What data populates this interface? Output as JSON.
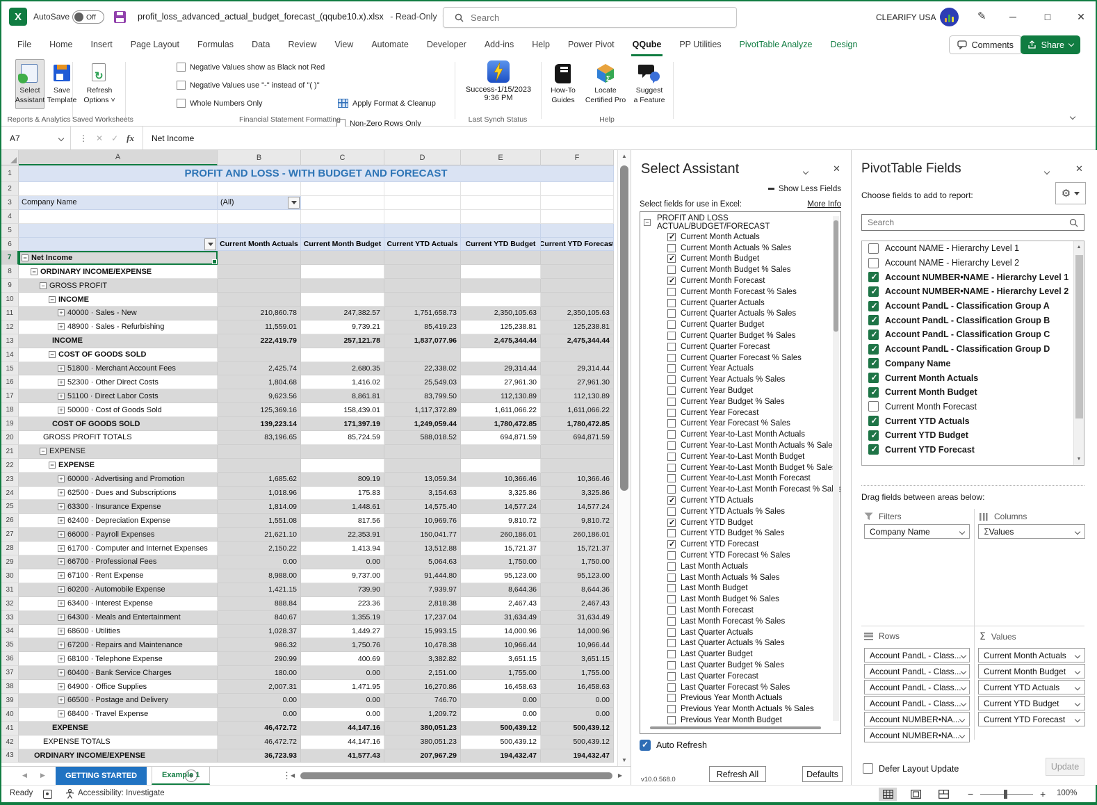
{
  "title_bar": {
    "autosave_label": "AutoSave",
    "autosave_state": "Off",
    "filename": "profit_loss_advanced_actual_budget_forecast_(qqube10.x).xlsx",
    "readonly": "-  Read-Only",
    "search_placeholder": "Search",
    "account_name": "CLEARIFY USA"
  },
  "menu_tabs": [
    {
      "label": "File"
    },
    {
      "label": "Home"
    },
    {
      "label": "Insert"
    },
    {
      "label": "Page Layout"
    },
    {
      "label": "Formulas"
    },
    {
      "label": "Data"
    },
    {
      "label": "Review"
    },
    {
      "label": "View"
    },
    {
      "label": "Automate"
    },
    {
      "label": "Developer"
    },
    {
      "label": "Add-ins"
    },
    {
      "label": "Help"
    },
    {
      "label": "Power Pivot"
    },
    {
      "label": "QQube",
      "active": true
    },
    {
      "label": "PP Utilities"
    },
    {
      "label": "PivotTable Analyze",
      "contextual": true
    },
    {
      "label": "Design",
      "contextual": true
    }
  ],
  "tab_actions": {
    "comments": "Comments",
    "share": "Share"
  },
  "ribbon": {
    "groups": [
      "Reports & Analytics",
      "Saved  Worksheets",
      "Financial Statement Formatting",
      "Last Synch Status",
      "Help"
    ],
    "select_assistant": "Select\nAssistant",
    "save_template": "Save\nTemplate",
    "refresh_options": "Refresh\nOptions ˅",
    "checkboxes_col1": [
      "Negative Values show as Black not Red",
      "Negative Values use \"-\" instead of \"( )\"",
      "Whole Numbers Only"
    ],
    "checkboxes_col2": [
      "Non-Zero Rows Only"
    ],
    "apply_format": "Apply Format & Cleanup",
    "synch_status": "Success-1/15/2023 9:36 PM",
    "howto": "How-To\nGuides",
    "locate": "Locate\nCertified Pro",
    "suggest": "Suggest\na Feature"
  },
  "formula_bar": {
    "cell_ref": "A7",
    "fx": "fx",
    "content": "Net Income"
  },
  "grid": {
    "columns": [
      "A",
      "B",
      "C",
      "D",
      "E",
      "F"
    ],
    "title": "PROFIT AND LOSS - WITH BUDGET AND FORECAST",
    "filter_label": "Company Name",
    "filter_value": "(All)",
    "value_headers": [
      "Current Month Actuals",
      "Current Month Budget",
      "Current YTD Actuals",
      "Current YTD Budget",
      "Current YTD Forecast"
    ],
    "rows": [
      {
        "n": 7,
        "label": "Net Income",
        "lvl": 0,
        "box": "-",
        "bold": true,
        "sel": true,
        "vals": [
          "",
          "",
          "",
          "",
          ""
        ]
      },
      {
        "n": 8,
        "label": "ORDINARY INCOME/EXPENSE",
        "lvl": 1,
        "box": "-",
        "bold": true,
        "vals": [
          "",
          "",
          "",
          "",
          ""
        ]
      },
      {
        "n": 9,
        "label": "GROSS PROFIT",
        "lvl": 2,
        "box": "-",
        "bold": false,
        "vals": [
          "",
          "",
          "",
          "",
          ""
        ]
      },
      {
        "n": 10,
        "label": "INCOME",
        "lvl": 3,
        "box": "-",
        "bold": true,
        "vals": [
          "",
          "",
          "",
          "",
          ""
        ]
      },
      {
        "n": 11,
        "label": "40000 · Sales - New",
        "lvl": 4,
        "box": "+",
        "bold": false,
        "vals": [
          "210,860.78",
          "247,382.57",
          "1,751,658.73",
          "2,350,105.63",
          "2,350,105.63"
        ]
      },
      {
        "n": 12,
        "label": "48900 · Sales - Refurbishing",
        "lvl": 4,
        "box": "+",
        "bold": false,
        "vals": [
          "11,559.01",
          "9,739.21",
          "85,419.23",
          "125,238.81",
          "125,238.81"
        ]
      },
      {
        "n": 13,
        "label": "INCOME",
        "lvl": 3,
        "box": "",
        "bold": true,
        "vals": [
          "222,419.79",
          "257,121.78",
          "1,837,077.96",
          "2,475,344.44",
          "2,475,344.44"
        ]
      },
      {
        "n": 14,
        "label": "COST OF GOODS SOLD",
        "lvl": 3,
        "box": "-",
        "bold": true,
        "vals": [
          "",
          "",
          "",
          "",
          ""
        ]
      },
      {
        "n": 15,
        "label": "51800 · Merchant Account Fees",
        "lvl": 4,
        "box": "+",
        "bold": false,
        "vals": [
          "2,425.74",
          "2,680.35",
          "22,338.02",
          "29,314.44",
          "29,314.44"
        ]
      },
      {
        "n": 16,
        "label": "52300 · Other Direct Costs",
        "lvl": 4,
        "box": "+",
        "bold": false,
        "vals": [
          "1,804.68",
          "1,416.02",
          "25,549.03",
          "27,961.30",
          "27,961.30"
        ]
      },
      {
        "n": 17,
        "label": "51100 · Direct Labor Costs",
        "lvl": 4,
        "box": "+",
        "bold": false,
        "vals": [
          "9,623.56",
          "8,861.81",
          "83,799.50",
          "112,130.89",
          "112,130.89"
        ]
      },
      {
        "n": 18,
        "label": "50000 · Cost of Goods Sold",
        "lvl": 4,
        "box": "+",
        "bold": false,
        "vals": [
          "125,369.16",
          "158,439.01",
          "1,117,372.89",
          "1,611,066.22",
          "1,611,066.22"
        ]
      },
      {
        "n": 19,
        "label": "COST OF GOODS SOLD",
        "lvl": 3,
        "box": "",
        "bold": true,
        "vals": [
          "139,223.14",
          "171,397.19",
          "1,249,059.44",
          "1,780,472.85",
          "1,780,472.85"
        ]
      },
      {
        "n": 20,
        "label": "GROSS PROFIT TOTALS",
        "lvl": 2,
        "box": "",
        "bold": false,
        "vals": [
          "83,196.65",
          "85,724.59",
          "588,018.52",
          "694,871.59",
          "694,871.59"
        ]
      },
      {
        "n": 21,
        "label": "EXPENSE",
        "lvl": 2,
        "box": "-",
        "bold": false,
        "vals": [
          "",
          "",
          "",
          "",
          ""
        ]
      },
      {
        "n": 22,
        "label": "EXPENSE",
        "lvl": 3,
        "box": "-",
        "bold": true,
        "vals": [
          "",
          "",
          "",
          "",
          ""
        ]
      },
      {
        "n": 23,
        "label": "60000 · Advertising and Promotion",
        "lvl": 4,
        "box": "+",
        "bold": false,
        "vals": [
          "1,685.62",
          "809.19",
          "13,059.34",
          "10,366.46",
          "10,366.46"
        ]
      },
      {
        "n": 24,
        "label": "62500 · Dues and Subscriptions",
        "lvl": 4,
        "box": "+",
        "bold": false,
        "vals": [
          "1,018.96",
          "175.83",
          "3,154.63",
          "3,325.86",
          "3,325.86"
        ]
      },
      {
        "n": 25,
        "label": "63300 · Insurance Expense",
        "lvl": 4,
        "box": "+",
        "bold": false,
        "vals": [
          "1,814.09",
          "1,448.61",
          "14,575.40",
          "14,577.24",
          "14,577.24"
        ]
      },
      {
        "n": 26,
        "label": "62400 · Depreciation Expense",
        "lvl": 4,
        "box": "+",
        "bold": false,
        "vals": [
          "1,551.08",
          "817.56",
          "10,969.76",
          "9,810.72",
          "9,810.72"
        ]
      },
      {
        "n": 27,
        "label": "66000 · Payroll Expenses",
        "lvl": 4,
        "box": "+",
        "bold": false,
        "vals": [
          "21,621.10",
          "22,353.91",
          "150,041.77",
          "260,186.01",
          "260,186.01"
        ]
      },
      {
        "n": 28,
        "label": "61700 · Computer and Internet Expenses",
        "lvl": 4,
        "box": "+",
        "bold": false,
        "vals": [
          "2,150.22",
          "1,413.94",
          "13,512.88",
          "15,721.37",
          "15,721.37"
        ]
      },
      {
        "n": 29,
        "label": "66700 · Professional Fees",
        "lvl": 4,
        "box": "+",
        "bold": false,
        "vals": [
          "0.00",
          "0.00",
          "5,064.63",
          "1,750.00",
          "1,750.00"
        ]
      },
      {
        "n": 30,
        "label": "67100 · Rent Expense",
        "lvl": 4,
        "box": "+",
        "bold": false,
        "vals": [
          "8,988.00",
          "9,737.00",
          "91,444.80",
          "95,123.00",
          "95,123.00"
        ]
      },
      {
        "n": 31,
        "label": "60200 · Automobile Expense",
        "lvl": 4,
        "box": "+",
        "bold": false,
        "vals": [
          "1,421.15",
          "739.90",
          "7,939.97",
          "8,644.36",
          "8,644.36"
        ]
      },
      {
        "n": 32,
        "label": "63400 · Interest Expense",
        "lvl": 4,
        "box": "+",
        "bold": false,
        "vals": [
          "888.84",
          "223.36",
          "2,818.38",
          "2,467.43",
          "2,467.43"
        ]
      },
      {
        "n": 33,
        "label": "64300 · Meals and Entertainment",
        "lvl": 4,
        "box": "+",
        "bold": false,
        "vals": [
          "840.67",
          "1,355.19",
          "17,237.04",
          "31,634.49",
          "31,634.49"
        ]
      },
      {
        "n": 34,
        "label": "68600 · Utilities",
        "lvl": 4,
        "box": "+",
        "bold": false,
        "vals": [
          "1,028.37",
          "1,449.27",
          "15,993.15",
          "14,000.96",
          "14,000.96"
        ]
      },
      {
        "n": 35,
        "label": "67200 · Repairs and Maintenance",
        "lvl": 4,
        "box": "+",
        "bold": false,
        "vals": [
          "986.32",
          "1,750.76",
          "10,478.38",
          "10,966.44",
          "10,966.44"
        ]
      },
      {
        "n": 36,
        "label": "68100 · Telephone Expense",
        "lvl": 4,
        "box": "+",
        "bold": false,
        "vals": [
          "290.99",
          "400.69",
          "3,382.82",
          "3,651.15",
          "3,651.15"
        ]
      },
      {
        "n": 37,
        "label": "60400 · Bank Service Charges",
        "lvl": 4,
        "box": "+",
        "bold": false,
        "vals": [
          "180.00",
          "0.00",
          "2,151.00",
          "1,755.00",
          "1,755.00"
        ]
      },
      {
        "n": 38,
        "label": "64900 · Office Supplies",
        "lvl": 4,
        "box": "+",
        "bold": false,
        "vals": [
          "2,007.31",
          "1,471.95",
          "16,270.86",
          "16,458.63",
          "16,458.63"
        ]
      },
      {
        "n": 39,
        "label": "66500 · Postage and Delivery",
        "lvl": 4,
        "box": "+",
        "bold": false,
        "vals": [
          "0.00",
          "0.00",
          "746.70",
          "0.00",
          "0.00"
        ]
      },
      {
        "n": 40,
        "label": "68400 · Travel Expense",
        "lvl": 4,
        "box": "+",
        "bold": false,
        "vals": [
          "0.00",
          "0.00",
          "1,209.72",
          "0.00",
          "0.00"
        ]
      },
      {
        "n": 41,
        "label": "EXPENSE",
        "lvl": 3,
        "box": "",
        "bold": true,
        "vals": [
          "46,472.72",
          "44,147.16",
          "380,051.23",
          "500,439.12",
          "500,439.12"
        ]
      },
      {
        "n": 42,
        "label": "EXPENSE TOTALS",
        "lvl": 2,
        "box": "",
        "bold": false,
        "vals": [
          "46,472.72",
          "44,147.16",
          "380,051.23",
          "500,439.12",
          "500,439.12"
        ]
      },
      {
        "n": 43,
        "label": "ORDINARY INCOME/EXPENSE",
        "lvl": 1,
        "box": "",
        "bold": true,
        "vals": [
          "36,723.93",
          "41,577.43",
          "207,967.29",
          "194,432.47",
          "194,432.47"
        ]
      }
    ]
  },
  "sheet_tabs": {
    "tabs": [
      {
        "label": "GETTING STARTED",
        "color": "blue"
      },
      {
        "label": "Example 1",
        "active": true
      }
    ]
  },
  "status_bar": {
    "ready": "Ready",
    "accessibility": "Accessibility: Investigate",
    "zoom": "100%"
  },
  "select_assistant": {
    "title": "Select Assistant",
    "show_less": "Show Less Fields",
    "select_label": "Select fields for use in Excel:",
    "more_info": "More Info",
    "root": "PROFIT AND LOSS ACTUAL/BUDGET/FORECAST",
    "items": [
      {
        "label": "Current Month Actuals",
        "checked": true
      },
      {
        "label": "Current Month Actuals % Sales",
        "checked": false
      },
      {
        "label": "Current Month Budget",
        "checked": true
      },
      {
        "label": "Current Month Budget % Sales",
        "checked": false
      },
      {
        "label": "Current Month Forecast",
        "checked": true
      },
      {
        "label": "Current Month Forecast % Sales",
        "checked": false
      },
      {
        "label": "Current Quarter Actuals",
        "checked": false
      },
      {
        "label": "Current Quarter Actuals % Sales",
        "checked": false
      },
      {
        "label": "Current Quarter Budget",
        "checked": false
      },
      {
        "label": "Current Quarter Budget % Sales",
        "checked": false
      },
      {
        "label": "Current Quarter Forecast",
        "checked": false
      },
      {
        "label": "Current Quarter Forecast % Sales",
        "checked": false
      },
      {
        "label": "Current Year Actuals",
        "checked": false
      },
      {
        "label": "Current Year Actuals % Sales",
        "checked": false
      },
      {
        "label": "Current Year Budget",
        "checked": false
      },
      {
        "label": "Current Year Budget % Sales",
        "checked": false
      },
      {
        "label": "Current Year Forecast",
        "checked": false
      },
      {
        "label": "Current Year Forecast % Sales",
        "checked": false
      },
      {
        "label": "Current Year-to-Last Month Actuals",
        "checked": false
      },
      {
        "label": "Current Year-to-Last Month Actuals % Sales",
        "checked": false
      },
      {
        "label": "Current Year-to-Last Month Budget",
        "checked": false
      },
      {
        "label": "Current Year-to-Last Month Budget % Sales",
        "checked": false
      },
      {
        "label": "Current Year-to-Last Month Forecast",
        "checked": false
      },
      {
        "label": "Current Year-to-Last Month Forecast % Sales",
        "checked": false
      },
      {
        "label": "Current YTD Actuals",
        "checked": true
      },
      {
        "label": "Current YTD Actuals % Sales",
        "checked": false
      },
      {
        "label": "Current YTD Budget",
        "checked": true
      },
      {
        "label": "Current YTD Budget % Sales",
        "checked": false
      },
      {
        "label": "Current YTD Forecast",
        "checked": true
      },
      {
        "label": "Current YTD Forecast % Sales",
        "checked": false
      },
      {
        "label": "Last Month Actuals",
        "checked": false
      },
      {
        "label": "Last Month Actuals % Sales",
        "checked": false
      },
      {
        "label": "Last Month Budget",
        "checked": false
      },
      {
        "label": "Last Month Budget % Sales",
        "checked": false
      },
      {
        "label": "Last Month Forecast",
        "checked": false
      },
      {
        "label": "Last Month Forecast % Sales",
        "checked": false
      },
      {
        "label": "Last Quarter Actuals",
        "checked": false
      },
      {
        "label": "Last Quarter Actuals % Sales",
        "checked": false
      },
      {
        "label": "Last Quarter Budget",
        "checked": false
      },
      {
        "label": "Last Quarter Budget % Sales",
        "checked": false
      },
      {
        "label": "Last Quarter Forecast",
        "checked": false
      },
      {
        "label": "Last Quarter Forecast % Sales",
        "checked": false
      },
      {
        "label": "Previous Year Month Actuals",
        "checked": false
      },
      {
        "label": "Previous Year Month Actuals % Sales",
        "checked": false
      },
      {
        "label": "Previous Year Month Budget",
        "checked": false
      }
    ],
    "auto_refresh": "Auto Refresh",
    "version": "v10.0.568.0",
    "refresh_all": "Refresh All",
    "defaults": "Defaults"
  },
  "pivot_fields": {
    "title": "PivotTable Fields",
    "choose_label": "Choose fields to add to report:",
    "search_placeholder": "Search",
    "fields": [
      {
        "label": "Account NAME - Hierarchy Level 1",
        "checked": false
      },
      {
        "label": "Account NAME - Hierarchy Level 2",
        "checked": false
      },
      {
        "label": "Account NUMBER•NAME - Hierarchy Level 1",
        "checked": true
      },
      {
        "label": "Account NUMBER•NAME - Hierarchy Level 2",
        "checked": true
      },
      {
        "label": "Account PandL - Classification Group A",
        "checked": true
      },
      {
        "label": "Account PandL - Classification Group B",
        "checked": true
      },
      {
        "label": "Account PandL - Classification Group C",
        "checked": true
      },
      {
        "label": "Account PandL - Classification Group D",
        "checked": true
      },
      {
        "label": "Company Name",
        "checked": true
      },
      {
        "label": "Current Month Actuals",
        "checked": true
      },
      {
        "label": "Current Month Budget",
        "checked": true
      },
      {
        "label": "Current Month Forecast",
        "checked": false
      },
      {
        "label": "Current YTD Actuals",
        "checked": true
      },
      {
        "label": "Current YTD Budget",
        "checked": true
      },
      {
        "label": "Current YTD Forecast",
        "checked": true
      }
    ],
    "drag_label": "Drag fields between areas below:",
    "filters_label": "Filters",
    "columns_label": "Columns",
    "rows_label": "Rows",
    "values_label": "Values",
    "filters_chips": [
      "Company Name"
    ],
    "columns_chips": [
      "Values"
    ],
    "rows_chips": [
      "Account PandL - Class...",
      "Account PandL - Class...",
      "Account PandL - Class...",
      "Account PandL - Class...",
      "Account NUMBER•NA...",
      "Account NUMBER•NA..."
    ],
    "values_chips": [
      "Current Month Actuals",
      "Current Month Budget",
      "Current YTD Actuals",
      "Current YTD Budget",
      "Current YTD Forecast"
    ],
    "defer": "Defer Layout Update",
    "update": "Update"
  }
}
